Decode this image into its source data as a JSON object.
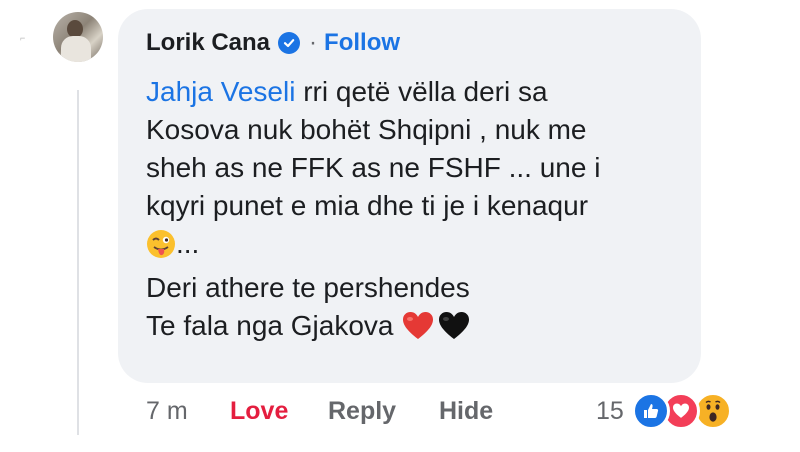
{
  "comment": {
    "author": "Lorik Cana",
    "separator": "·",
    "follow_label": "Follow",
    "mention": "Jahja Veseli",
    "lines": [
      " rri qetë vëlla deri sa",
      "Kosova nuk bohët Shqipni , nuk me",
      "sheh as ne FFK as ne FSHF ... une i",
      "kqyri punet e mia dhe  ti je i kenaqur",
      "...",
      "Deri athere te pershendes",
      "Te fala nga Gjakova"
    ]
  },
  "actions": {
    "time": "7 m",
    "love_label": "Love",
    "reply_label": "Reply",
    "hide_label": "Hide",
    "reaction_count": "15"
  },
  "icons": {
    "verified": "verified-badge-icon",
    "wink": "winking-tongue-emoji",
    "red_heart": "red-heart-emoji",
    "black_heart": "black-heart-emoji",
    "like": "like-reaction-icon",
    "love": "love-reaction-icon",
    "wow": "wow-reaction-icon"
  },
  "colors": {
    "link": "#1b74e4",
    "love": "#e41e3f",
    "bubble": "#f0f2f5",
    "muted": "#65676b"
  }
}
